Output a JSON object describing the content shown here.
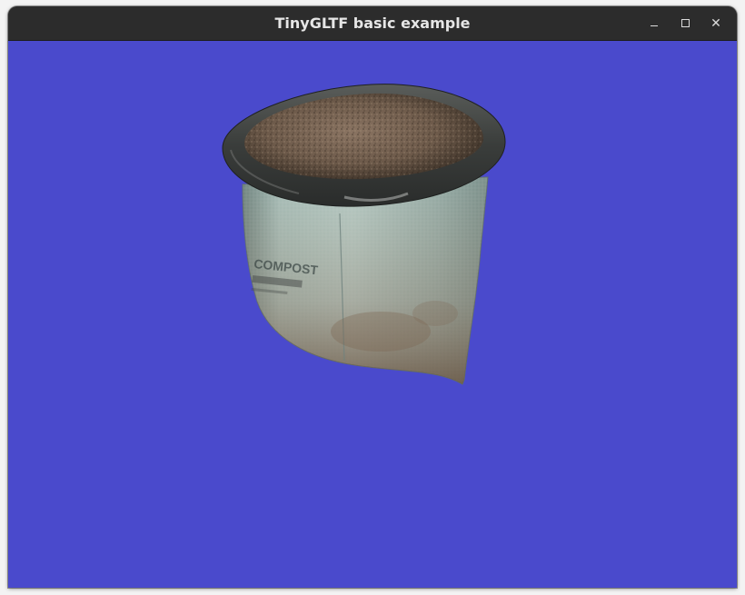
{
  "window": {
    "title": "TinyGLTF basic example",
    "buttons": [
      "minimize",
      "maximize",
      "close"
    ]
  },
  "viewport": {
    "background_color": "#4a4acc",
    "model": {
      "description_icon": "compost-bag-model",
      "label_text": "COMPOST"
    }
  },
  "colors": {
    "titlebar": "#2c2c2c",
    "title_text": "#e6e6e6",
    "bag": "#9bb4ae",
    "soil": "#6a5646",
    "rim": "#3c3f3c"
  }
}
